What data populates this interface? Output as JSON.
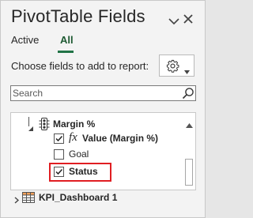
{
  "pane": {
    "title": "PivotTable Fields",
    "close_icon": "close-icon",
    "pin_icon": "chevron-down-icon"
  },
  "tabs": [
    {
      "label": "Active",
      "selected": false
    },
    {
      "label": "All",
      "selected": true
    }
  ],
  "choose_label": "Choose fields to add to report:",
  "tools_button": {
    "icon": "gear-icon",
    "dropdown_icon": "caret-down-icon"
  },
  "search": {
    "placeholder": "Search",
    "value": "",
    "icon": "search-icon"
  },
  "field_list": {
    "group": {
      "name": "Margin %",
      "expanded": true,
      "icon": "kpi-traffic-light-icon"
    },
    "items": [
      {
        "label": "Value (Margin %)",
        "checked": true,
        "bold": true,
        "icon": "fx-icon"
      },
      {
        "label": "Goal",
        "checked": false,
        "bold": false
      },
      {
        "label": "Status",
        "checked": true,
        "bold": true,
        "highlighted": true
      }
    ],
    "collapsed_table": {
      "name": "KPI_Dashboard 1",
      "icon": "table-icon",
      "expanded": false
    }
  },
  "colors": {
    "accent": "#217346",
    "highlight": "#e01e22"
  }
}
